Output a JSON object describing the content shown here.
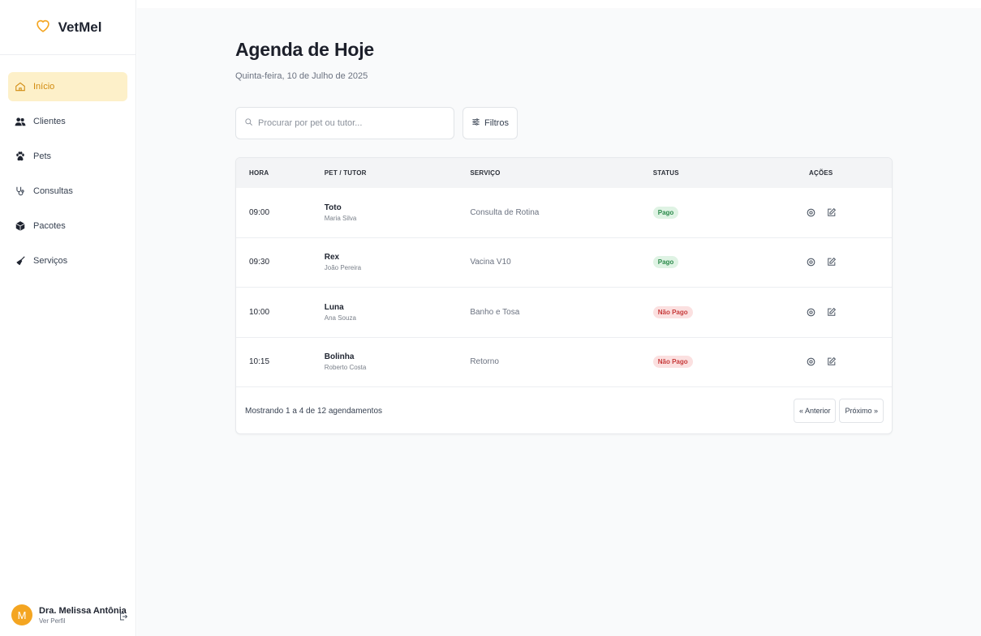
{
  "brand": {
    "name": "VetMel"
  },
  "sidebar": {
    "items": [
      {
        "label": "Início",
        "icon": "home-icon",
        "active": true
      },
      {
        "label": "Clientes",
        "icon": "users-icon",
        "active": false
      },
      {
        "label": "Pets",
        "icon": "paw-icon",
        "active": false
      },
      {
        "label": "Consultas",
        "icon": "stethoscope-icon",
        "active": false
      },
      {
        "label": "Pacotes",
        "icon": "package-icon",
        "active": false
      },
      {
        "label": "Serviços",
        "icon": "broom-icon",
        "active": false
      }
    ]
  },
  "user": {
    "initial": "M",
    "name": "Dra. Melissa Antônia",
    "link": "Ver Perfil"
  },
  "page": {
    "title": "Agenda de Hoje",
    "date": "Quinta-feira, 10 de Julho de 2025"
  },
  "search": {
    "placeholder": "Procurar por pet ou tutor..."
  },
  "filters": {
    "label": "Filtros"
  },
  "table": {
    "headers": {
      "hora": "HORA",
      "pet": "PET / TUTOR",
      "servico": "SERVIÇO",
      "status": "STATUS",
      "acoes": "AÇÕES"
    },
    "rows": [
      {
        "hora": "09:00",
        "pet": "Toto",
        "tutor": "Maria Silva",
        "servico": "Consulta de Rotina",
        "status": "Pago"
      },
      {
        "hora": "09:30",
        "pet": "Rex",
        "tutor": "João Pereira",
        "servico": "Vacina V10",
        "status": "Pago"
      },
      {
        "hora": "10:00",
        "pet": "Luna",
        "tutor": "Ana Souza",
        "servico": "Banho e Tosa",
        "status": "Não Pago"
      },
      {
        "hora": "10:15",
        "pet": "Bolinha",
        "tutor": "Roberto Costa",
        "servico": "Retorno",
        "status": "Não Pago"
      }
    ],
    "footer": "Mostrando 1 a 4 de 12 agendamentos",
    "prev": "« Anterior",
    "next": "Próximo »"
  },
  "colors": {
    "accent": "#f4a521",
    "active_bg": "#fdf0c9",
    "paid": "#2a8a4a",
    "unpaid": "#c73a3a"
  }
}
